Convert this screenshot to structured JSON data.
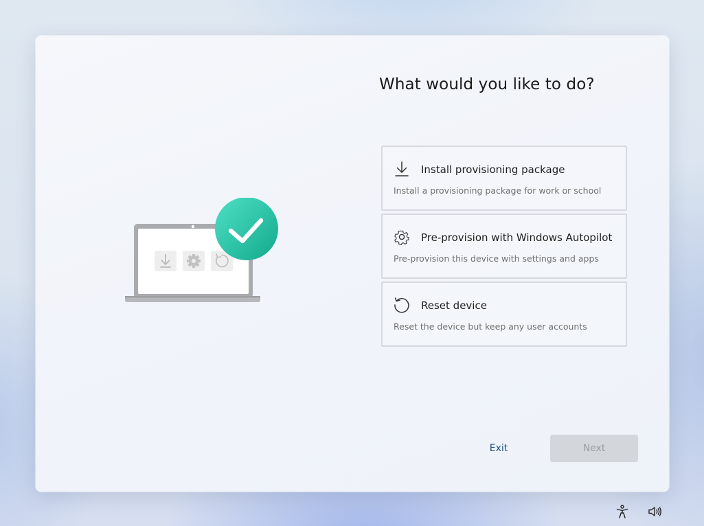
{
  "dialog": {
    "title": "What would you like to do?",
    "options": [
      {
        "icon": "download-icon",
        "title": "Install provisioning package",
        "description": "Install a provisioning package for work or school"
      },
      {
        "icon": "gear-icon",
        "title": "Pre-provision with Windows Autopilot",
        "description": "Pre-provision this device with settings and apps"
      },
      {
        "icon": "reset-icon",
        "title": "Reset device",
        "description": "Reset the device but keep any user accounts"
      }
    ],
    "exit_label": "Exit",
    "next_label": "Next"
  },
  "illustration": {
    "laptop_icons": [
      "download-icon",
      "gear-icon",
      "reset-icon"
    ],
    "badge_icon": "checkmark-icon",
    "badge_color": "#2dc9ac"
  },
  "tray": {
    "icons": [
      "accessibility-icon",
      "volume-icon"
    ]
  },
  "colors": {
    "link": "#1f4f85",
    "button_disabled_bg": "#d3d6db",
    "button_disabled_text": "#9a9da2"
  }
}
